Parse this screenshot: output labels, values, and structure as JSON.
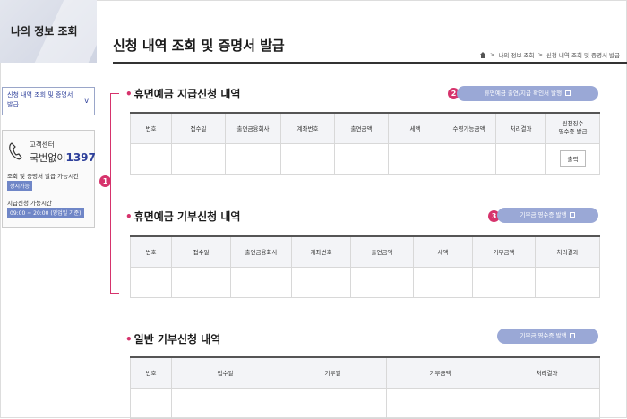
{
  "sidebar": {
    "title": "나의 정보 조회",
    "menu_label": "신청 내역 조회 및 증명서 발급",
    "menu_chevron": "v",
    "call_center_label": "고객센터",
    "call_center_prefix": "국번없이",
    "call_center_number": "1397",
    "inquiry_hours_label": "조회 및 증명서 발급 가능시간",
    "inquiry_hours_value": "상시가능",
    "payment_hours_label": "지급신청 가능시간",
    "payment_hours_value": "09:00 ~ 20:00 (영업일 기준)"
  },
  "header": {
    "title": "신청 내역 조회 및 증명서 발급",
    "breadcrumb": [
      "나의 정보 조회",
      "신청 내역 조회 및 증명서 발급"
    ],
    "breadcrumb_sep": ">"
  },
  "sections": {
    "payment": {
      "title": "휴면예금 지급신청 내역",
      "button": "휴면예금 출연/지급 확인서 발행",
      "marker": "2",
      "columns": [
        "번호",
        "접수일",
        "출연금융회사",
        "계좌번호",
        "출연금액",
        "세액",
        "수령가능금액",
        "처리결과",
        "원천징수\n영수증 발급"
      ],
      "row_button": "출력"
    },
    "donation": {
      "title": "휴면예금 기부신청 내역",
      "button": "기부금 영수증 발행",
      "marker": "3",
      "columns": [
        "번호",
        "접수일",
        "출연금융회사",
        "계좌번호",
        "출연금액",
        "세액",
        "기부금액",
        "처리결과"
      ]
    },
    "general": {
      "title": "일반 기부신청 내역",
      "button": "기부금 영수증 발행",
      "columns": [
        "번호",
        "접수일",
        "기부일",
        "기부금액",
        "처리결과"
      ]
    },
    "bracket_marker": "1"
  },
  "colors": {
    "accent": "#d6336c",
    "button": "#9aa8d6",
    "brand": "#2d3f9a"
  },
  "icons": [
    "home-icon",
    "phone-icon",
    "external-link-icon",
    "chevron-down-icon"
  ]
}
